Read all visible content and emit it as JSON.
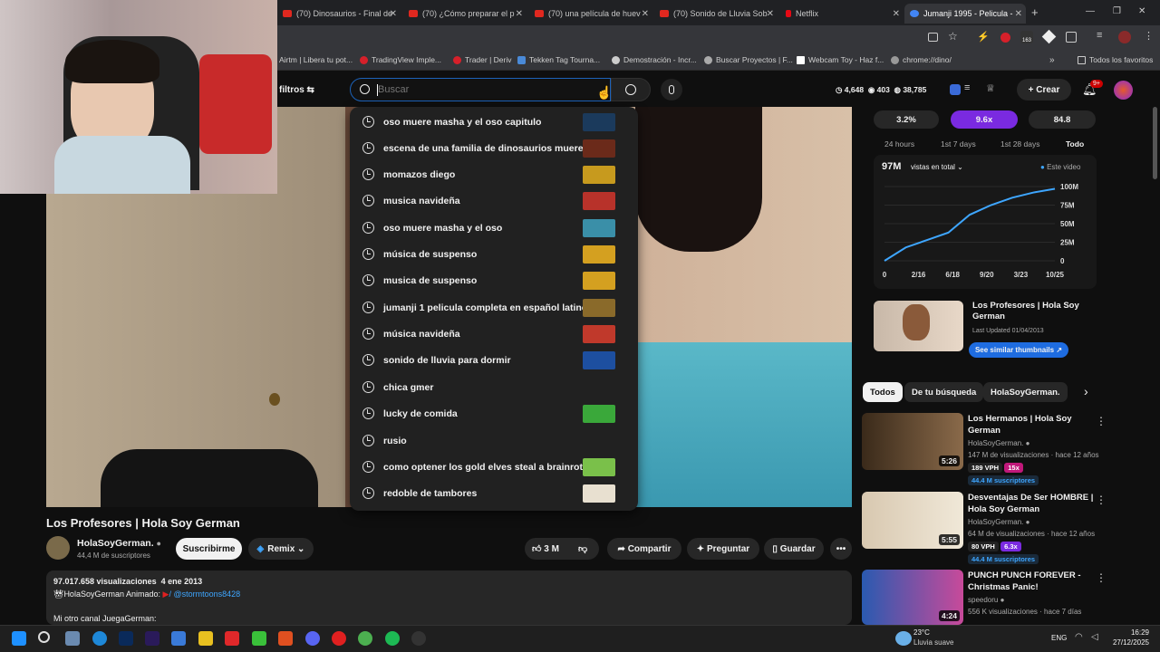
{
  "browser": {
    "tabs": [
      {
        "label": "(70) Dinosaurios - Final de"
      },
      {
        "label": "(70) ¿Cómo preparar el p"
      },
      {
        "label": "(70) una película de huev"
      },
      {
        "label": "(70) Sonido de Lluvia Sob"
      },
      {
        "label": "Netflix"
      },
      {
        "label": "Jumanji 1995 - Pelicula -"
      }
    ],
    "new_tab": "+",
    "window_controls": [
      "—",
      "❐",
      "✕"
    ],
    "bookmarks": [
      {
        "label": "Airtm | Libera tu pot..."
      },
      {
        "label": "TradingView Imple..."
      },
      {
        "label": "Trader | Deriv"
      },
      {
        "label": "Tekken Tag Tourna..."
      },
      {
        "label": "Demostración - Incr..."
      },
      {
        "label": "Buscar Proyectos | F..."
      },
      {
        "label": "Webcam Toy - Haz f..."
      },
      {
        "label": "chrome://dino/"
      }
    ],
    "all_favorites": "Todos los favoritos",
    "ext_badge": "163"
  },
  "header": {
    "filters_label": "filtros",
    "search_placeholder": "Buscar",
    "stats": [
      "4,648",
      "403",
      "38,785"
    ],
    "create_label": "Crear",
    "notif_badge": "9+"
  },
  "suggestions": [
    {
      "text": "oso muere masha y el oso capitulo",
      "thumb": "#1b3a5c"
    },
    {
      "text": "escena de una familia de dinosaurios mueren",
      "thumb": "#6b2a1a"
    },
    {
      "text": "momazos diego",
      "thumb": "#c79a1e"
    },
    {
      "text": "musica navideña",
      "thumb": "#b8322a"
    },
    {
      "text": "oso muere masha y el oso",
      "thumb": "#3a8fa8"
    },
    {
      "text": "música de suspenso",
      "thumb": "#d4a020"
    },
    {
      "text": "musica de suspenso",
      "thumb": "#d4a020"
    },
    {
      "text": "jumanji 1 pelicula completa en español latino",
      "thumb": "#8a6a2a"
    },
    {
      "text": "música navideña",
      "thumb": "#c0392b"
    },
    {
      "text": "sonido de lluvia para dormir",
      "thumb": "#1d4fa0"
    },
    {
      "text": "chica gmer",
      "thumb": ""
    },
    {
      "text": "lucky de comida",
      "thumb": "#3aa83a"
    },
    {
      "text": "rusio",
      "thumb": ""
    },
    {
      "text": "como optener los gold elves steal a brainrot",
      "thumb": "#7ac04a"
    },
    {
      "text": "redoble de tambores",
      "thumb": "#e8e0d0"
    }
  ],
  "video": {
    "title": "Los Profesores | Hola Soy German",
    "channel": "HolaSoyGerman.",
    "subscribers": "44,4 M de suscriptores",
    "subscribe_label": "Suscribirme",
    "remix_label": "Remix",
    "likes": "3 M",
    "share_label": "Compartir",
    "ask_label": "Preguntar",
    "save_label": "Guardar",
    "more_label": "•••",
    "views": "97.017.658 visualizaciones",
    "date": "4 ene 2013",
    "desc_line1": "HolaSoyGerman Animado:",
    "desc_handle": "/ @stormtoons8428",
    "desc_line2": "Mi otro canal JuegaGerman:"
  },
  "analytics": {
    "pills": [
      "3.2%",
      "9.6x",
      "84.8"
    ],
    "ranges": [
      "24 hours",
      "1st 7 days",
      "1st 28 days",
      "Todo"
    ],
    "total": "97M",
    "total_label": "vistas en total",
    "legend": "Este video",
    "thumb_title": "Los Profesores | Hola Soy German",
    "last_updated": "Last Updated 01/04/2013",
    "similar_label": "See similar thumbnails"
  },
  "chart_data": {
    "type": "line",
    "x": [
      "0",
      "2/16",
      "6/18",
      "9/20",
      "3/23",
      "10/25"
    ],
    "y_ticks": [
      "100M",
      "75M",
      "50M",
      "25M",
      "0"
    ],
    "series": [
      {
        "values": [
          0,
          18,
          28,
          38,
          62,
          75,
          85,
          92,
          97
        ]
      }
    ],
    "ylim": [
      0,
      100
    ]
  },
  "chips": [
    "Todos",
    "De tu búsqueda",
    "HolaSoyGerman."
  ],
  "recommendations": [
    {
      "title": "Los Hermanos | Hola Soy German",
      "channel": "HolaSoyGerman.",
      "meta": "147 M de visualizaciones · hace 12 años",
      "vph": "189 VPH",
      "mult": "15x",
      "subs": "44.4 M suscriptores",
      "duration": "5:26",
      "thumb": "#6a4a2a"
    },
    {
      "title": "Desventajas De Ser HOMBRE | Hola Soy German",
      "channel": "HolaSoyGerman.",
      "meta": "64 M de visualizaciones · hace 12 años",
      "vph": "80 VPH",
      "mult": "6.3x",
      "subs": "44.4 M suscriptores",
      "duration": "5:55",
      "thumb": "#c9b8a0"
    },
    {
      "title": "PUNCH PUNCH FOREVER - Christmas Panic!",
      "channel": "speedoru",
      "meta": "556 K visualizaciones · hace 7 días",
      "vph": "",
      "mult": "",
      "subs": "",
      "duration": "4:24",
      "thumb": "#3a6ac0"
    }
  ],
  "taskbar": {
    "weather_temp": "23°C",
    "weather_desc": "Lluvia suave",
    "lang": "ENG",
    "time": "16:29",
    "date": "27/12/2025"
  }
}
